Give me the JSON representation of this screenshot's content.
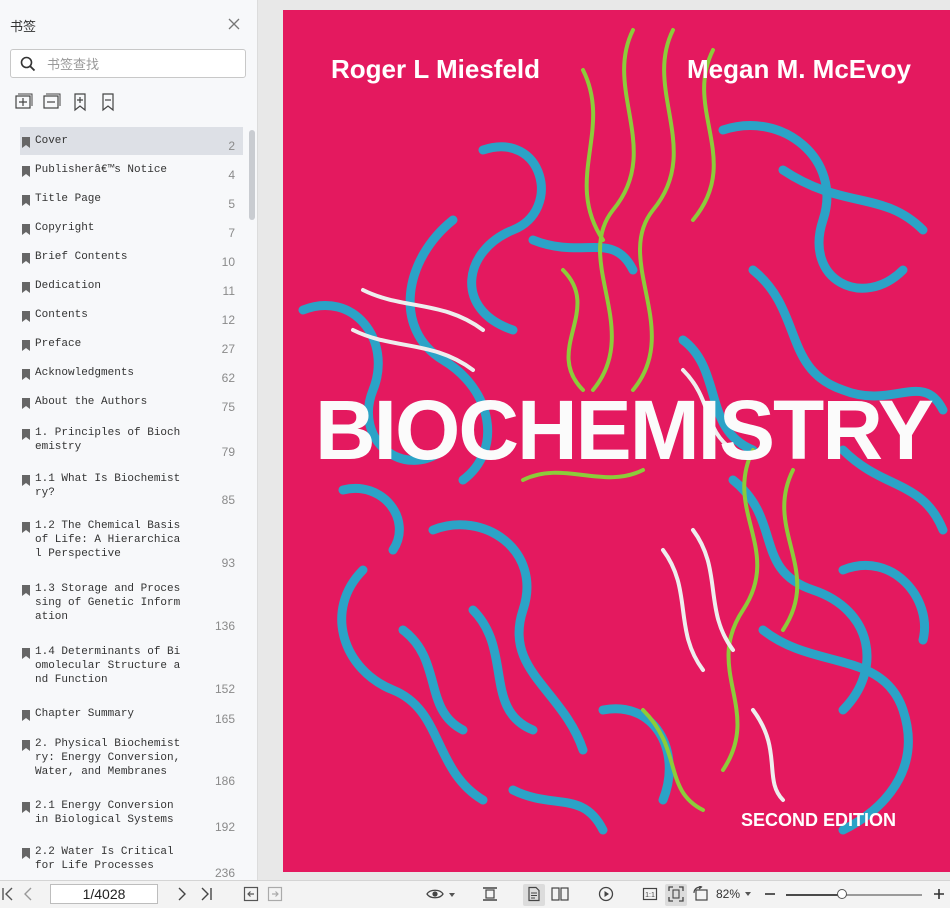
{
  "sidebar": {
    "title": "书签",
    "search_placeholder": "书签查找",
    "bookmarks": [
      {
        "label": "Cover",
        "page": "2"
      },
      {
        "label": "Publisherâ€™s Notice",
        "page": "4"
      },
      {
        "label": "Title Page",
        "page": "5"
      },
      {
        "label": "Copyright",
        "page": "7"
      },
      {
        "label": "Brief Contents",
        "page": "10"
      },
      {
        "label": "Dedication",
        "page": "11"
      },
      {
        "label": "Contents",
        "page": "12"
      },
      {
        "label": "Preface",
        "page": "27"
      },
      {
        "label": "Acknowledgments",
        "page": "62"
      },
      {
        "label": "About the Authors",
        "page": "75"
      },
      {
        "label": "1. Principles of Biochemistry",
        "page": "79"
      },
      {
        "label": "1.1 What Is Biochemistry?",
        "page": "85"
      },
      {
        "label": "1.2 The Chemical Basis of Life: A Hierarchical Perspective",
        "page": "93"
      },
      {
        "label": "1.3 Storage and Processing of Genetic Information",
        "page": "136"
      },
      {
        "label": "1.4 Determinants of Biomolecular Structure and Function",
        "page": "152"
      },
      {
        "label": "Chapter Summary",
        "page": "165"
      },
      {
        "label": "2. Physical Biochemistry: Energy Conversion, Water, and Membranes",
        "page": "186"
      },
      {
        "label": "2.1 Energy Conversion in Biological Systems",
        "page": "192"
      },
      {
        "label": "2.2 Water Is Critical for Life Processes",
        "page": "236"
      }
    ]
  },
  "cover": {
    "author1": "Roger L Miesfeld",
    "author2": "Megan M. McEvoy",
    "title": "BIOCHEMISTRY",
    "edition": "SECOND EDITION"
  },
  "toolbar": {
    "page_value": "1/4028",
    "zoom_label": "82%",
    "zoom_fraction": 0.41
  },
  "colors": {
    "cover_background": "#e4195f",
    "protein_ribbon": "#2ba3c7",
    "dna_green": "#8ccc3a",
    "dna_white": "#eeeeee",
    "selected_bookmark": "#dde0e6"
  }
}
